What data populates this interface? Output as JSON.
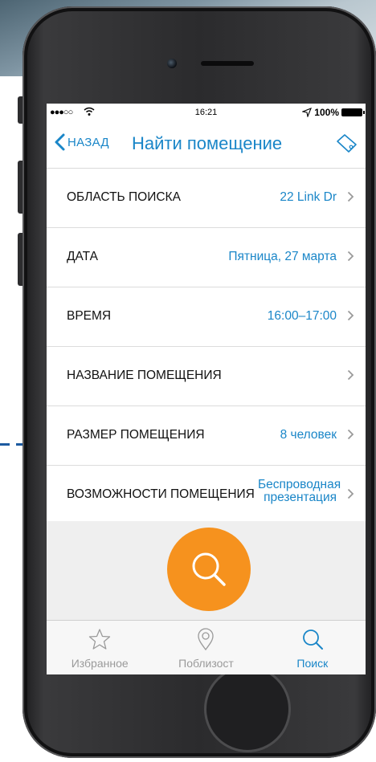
{
  "status_bar": {
    "signal": "●●●○○",
    "wifi_icon": "wifi-icon",
    "time": "16:21",
    "location_icon": "location-arrow-icon",
    "battery_percent": "100%"
  },
  "navbar": {
    "back_label": "НАЗАД",
    "title": "Найти помещение",
    "tag_icon": "tag-icon"
  },
  "rows": [
    {
      "label": "ОБЛАСТЬ ПОИСКА",
      "value": "22 Link Dr"
    },
    {
      "label": "ДАТА",
      "value": "Пятница, 27 марта"
    },
    {
      "label": "ВРЕМЯ",
      "value": "16:00–17:00"
    },
    {
      "label": "НАЗВАНИЕ ПОМЕЩЕНИЯ",
      "value": ""
    },
    {
      "label": "РАЗМЕР ПОМЕЩЕНИЯ",
      "value": "8 человек"
    },
    {
      "label": "ВОЗМОЖНОСТИ ПОМЕЩЕНИЯ",
      "value_line1": "Беспроводная",
      "value_line2": "презентация"
    }
  ],
  "tabs": [
    {
      "label": "Избранное",
      "icon": "star-icon",
      "active": false
    },
    {
      "label": "Поблизост",
      "icon": "map-pin-icon",
      "active": false
    },
    {
      "label": "Поиск",
      "icon": "search-icon",
      "active": true
    }
  ],
  "colors": {
    "accent": "#1a86c8",
    "fab": "#f6921e",
    "inactive": "#9a9a9a"
  }
}
